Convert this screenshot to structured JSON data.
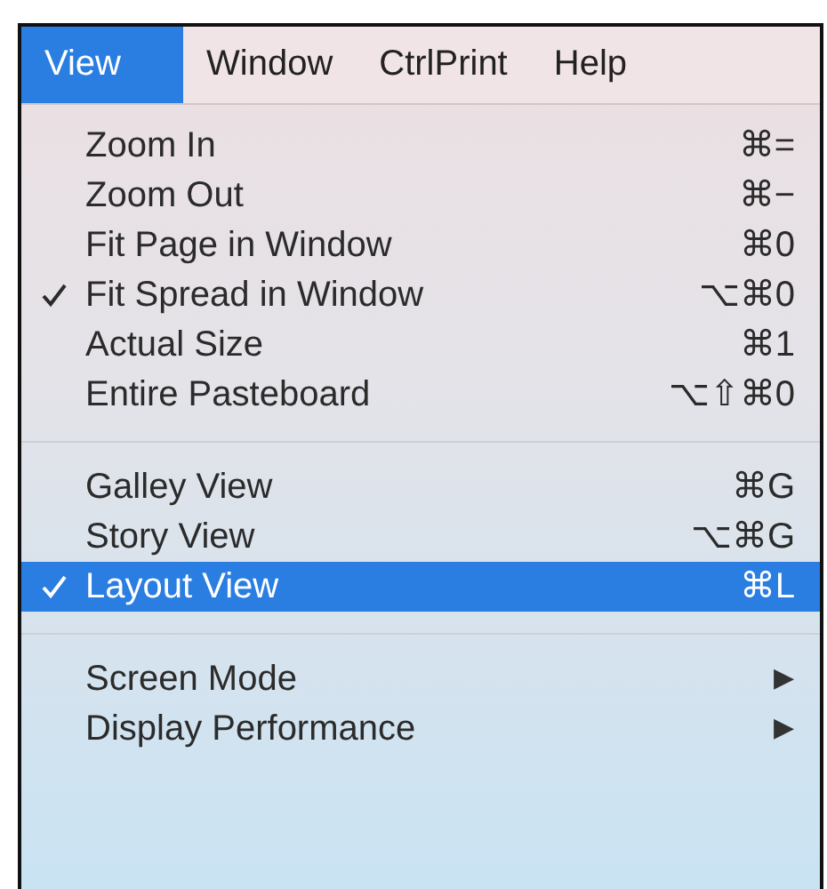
{
  "menu_bar": [
    {
      "label": "View",
      "selected": true
    },
    {
      "label": "Window",
      "selected": false
    },
    {
      "label": "CtrlPrint",
      "selected": false
    },
    {
      "label": "Help",
      "selected": false
    }
  ],
  "menu": {
    "items": [
      {
        "kind": "item",
        "label": "Zoom In",
        "shortcut": "⌘=",
        "checked": false,
        "selected": false
      },
      {
        "kind": "item",
        "label": "Zoom Out",
        "shortcut": "⌘−",
        "checked": false,
        "selected": false
      },
      {
        "kind": "item",
        "label": "Fit Page in Window",
        "shortcut": "⌘0",
        "checked": false,
        "selected": false
      },
      {
        "kind": "item",
        "label": "Fit Spread in Window",
        "shortcut": "⌥⌘0",
        "checked": true,
        "selected": false
      },
      {
        "kind": "item",
        "label": "Actual Size",
        "shortcut": "⌘1",
        "checked": false,
        "selected": false
      },
      {
        "kind": "item",
        "label": "Entire Pasteboard",
        "shortcut": "⌥⇧⌘0",
        "checked": false,
        "selected": false
      },
      {
        "kind": "separator"
      },
      {
        "kind": "item",
        "label": "Galley View",
        "shortcut": "⌘G",
        "checked": false,
        "selected": false
      },
      {
        "kind": "item",
        "label": "Story View",
        "shortcut": "⌥⌘G",
        "checked": false,
        "selected": false
      },
      {
        "kind": "item",
        "label": "Layout View",
        "shortcut": "⌘L",
        "checked": true,
        "selected": true
      },
      {
        "kind": "separator"
      },
      {
        "kind": "submenu",
        "label": "Screen Mode",
        "arrow": "▶",
        "checked": false,
        "selected": false
      },
      {
        "kind": "submenu",
        "label": "Display Performance",
        "arrow": "▶",
        "checked": false,
        "selected": false
      }
    ]
  }
}
